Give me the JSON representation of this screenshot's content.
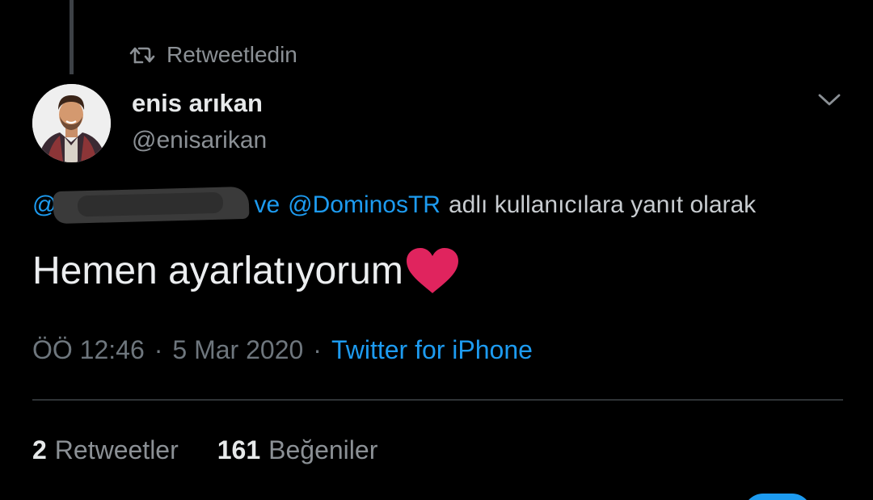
{
  "retweet_context": {
    "icon": "retweet-icon",
    "label": "Retweetledin"
  },
  "author": {
    "display_name": "enis arıkan",
    "handle": "@enisarikan",
    "avatar": "profile-photo"
  },
  "menu": {
    "icon": "chevron-down-icon"
  },
  "reply_context": {
    "redacted_mention_prefix": "@",
    "connector": "ve",
    "mention": "@DominosTR",
    "text": "adlı kullanıcılara yanıt olarak"
  },
  "tweet": {
    "text": "Hemen ayarlatıyorum",
    "emoji": "heart-icon"
  },
  "meta": {
    "time": "ÖÖ 12:46",
    "dot1": "·",
    "date": "5 Mar 2020",
    "dot2": "·",
    "source": "Twitter for iPhone"
  },
  "stats": {
    "retweets_count": "2",
    "retweets_label": "Retweetler",
    "likes_count": "161",
    "likes_label": "Beğeniler"
  },
  "colors": {
    "background": "#000000",
    "accent": "#1d9bf0",
    "heart": "#e0245e",
    "secondary_text": "#8b9095"
  }
}
